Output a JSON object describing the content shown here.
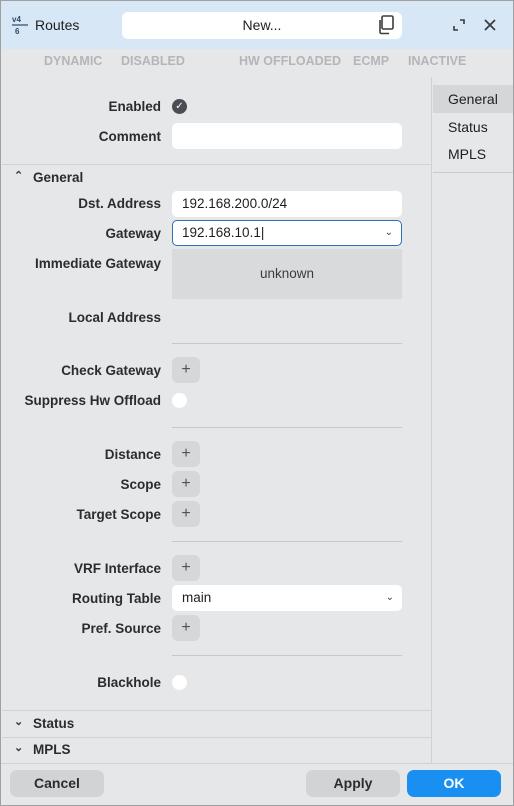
{
  "window": {
    "icon": "routes-v4-icon",
    "title": "Routes",
    "name_field": "New..."
  },
  "status_tabs": [
    "DYNAMIC",
    "DISABLED",
    "HW OFFLOADED",
    "ECMP",
    "INACTIVE"
  ],
  "top_fields": {
    "enabled_label": "Enabled",
    "enabled_checked": true,
    "comment_label": "Comment",
    "comment_value": ""
  },
  "sections": {
    "general": "General",
    "status": "Status",
    "mpls": "MPLS"
  },
  "general": {
    "dst_label": "Dst. Address",
    "dst_value": "192.168.200.0/24",
    "gateway_label": "Gateway",
    "gateway_value": "192.168.10.1",
    "imm_gw_label": "Immediate Gateway",
    "imm_gw_value": "unknown",
    "local_addr_label": "Local Address",
    "check_gw_label": "Check Gateway",
    "suppress_label": "Suppress Hw Offload",
    "distance_label": "Distance",
    "scope_label": "Scope",
    "target_scope_label": "Target Scope",
    "vrf_label": "VRF Interface",
    "routing_table_label": "Routing Table",
    "routing_table_value": "main",
    "pref_source_label": "Pref. Source",
    "blackhole_label": "Blackhole",
    "plus": "+"
  },
  "side_nav": [
    "General",
    "Status",
    "MPLS"
  ],
  "buttons": {
    "cancel": "Cancel",
    "apply": "Apply",
    "ok": "OK"
  },
  "colors": {
    "accent": "#1a8ff2",
    "titlebar": "#d8e7f6",
    "focus_border": "#2f6fb8"
  }
}
